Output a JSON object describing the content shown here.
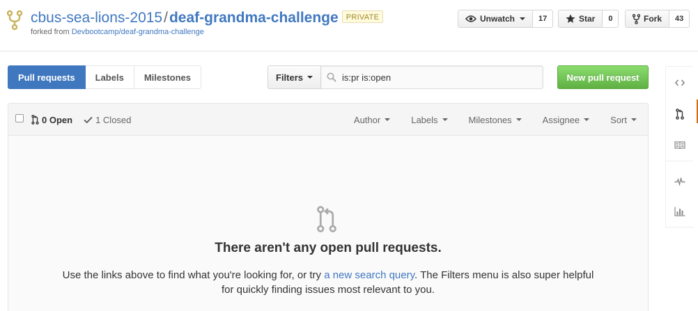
{
  "repo": {
    "owner": "cbus-sea-lions-2015",
    "separator": "/",
    "name": "deaf-grandma-challenge",
    "visibility": "PRIVATE",
    "forked_from_label": "forked from",
    "forked_from_repo": "Devbootcamp/deaf-grandma-challenge"
  },
  "actions": {
    "watch_label": "Unwatch",
    "watch_count": "17",
    "star_label": "Star",
    "star_count": "0",
    "fork_label": "Fork",
    "fork_count": "43"
  },
  "subnav": {
    "tabs": [
      {
        "label": "Pull requests",
        "selected": true
      },
      {
        "label": "Labels",
        "selected": false
      },
      {
        "label": "Milestones",
        "selected": false
      }
    ],
    "filters_label": "Filters",
    "search_value": "is:pr is:open",
    "new_pr_label": "New pull request"
  },
  "table": {
    "open_label": "0 Open",
    "closed_label": "1 Closed",
    "filters": [
      "Author",
      "Labels",
      "Milestones",
      "Assignee",
      "Sort"
    ]
  },
  "blankslate": {
    "title": "There aren't any open pull requests.",
    "text_before": "Use the links above to find what you're looking for, or try ",
    "link_text": "a new search query",
    "text_after": ". The Filters menu is also super helpful for quickly finding issues most relevant to you."
  },
  "reponav": [
    "code-icon",
    "pull-request-icon",
    "wiki-icon",
    "pulse-icon",
    "graph-icon"
  ],
  "colors": {
    "link": "#4078c0",
    "selected_tab": "#4078c0",
    "new_pr": "#6cc644",
    "nav_accent": "#d26911",
    "private_badge": "#a1882b"
  }
}
